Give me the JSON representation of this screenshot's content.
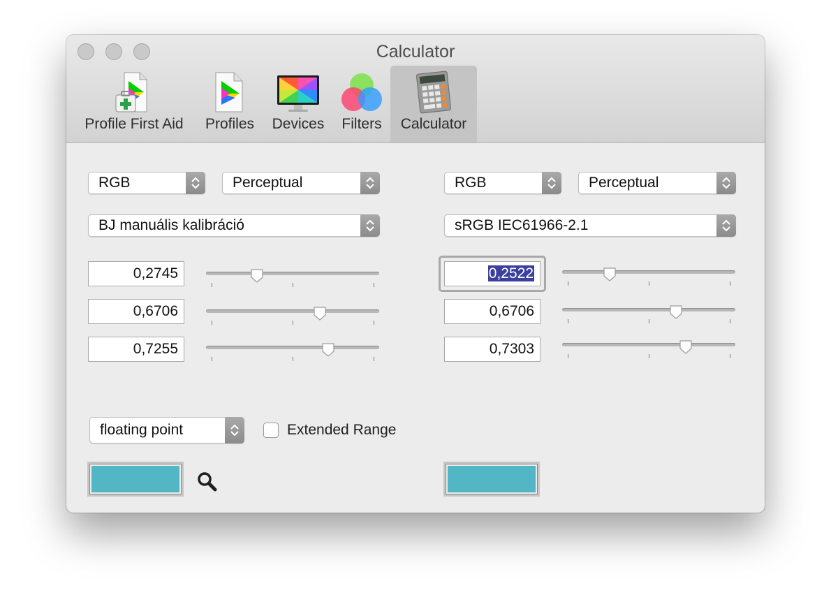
{
  "window": {
    "title": "Calculator"
  },
  "tabs": [
    {
      "label": "Profile First Aid",
      "icon": "profile-first-aid-icon"
    },
    {
      "label": "Profiles",
      "icon": "profiles-icon"
    },
    {
      "label": "Devices",
      "icon": "devices-icon"
    },
    {
      "label": "Filters",
      "icon": "filters-icon"
    },
    {
      "label": "Calculator",
      "icon": "calculator-icon",
      "selected": true
    }
  ],
  "left": {
    "color_space": "RGB",
    "intent": "Perceptual",
    "profile": "BJ manuális kalibráció",
    "channels": [
      {
        "value": "0,2745",
        "slider": 0.2745
      },
      {
        "value": "0,6706",
        "slider": 0.6706
      },
      {
        "value": "0,7255",
        "slider": 0.7255
      }
    ],
    "swatch_color": "#52b6c4"
  },
  "right": {
    "color_space": "RGB",
    "intent": "Perceptual",
    "profile": "sRGB IEC61966-2.1",
    "channels": [
      {
        "value": "0,2522",
        "slider": 0.2522,
        "selected": true
      },
      {
        "value": "0,6706",
        "slider": 0.6706
      },
      {
        "value": "0,7303",
        "slider": 0.7303
      }
    ],
    "swatch_color": "#52b6c4"
  },
  "bottom": {
    "number_format": "floating point",
    "extended_range_label": "Extended Range",
    "extended_range_checked": false
  },
  "colors": {
    "selection": "#3b3f9e",
    "swatch": "#52b6c4"
  }
}
